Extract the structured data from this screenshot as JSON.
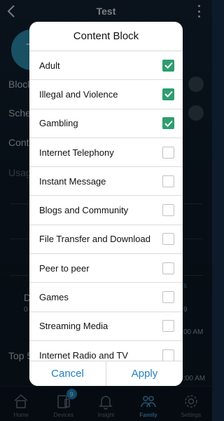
{
  "header": {
    "title": "Test"
  },
  "background": {
    "avatar_initial": "T",
    "block_label": "Block",
    "schedule_label": "Sche",
    "content_label": "Conte",
    "usage_label": "Usag",
    "day_label": "D",
    "day_sub": "0",
    "right_sub_a": "s",
    "right_sub_b": "9",
    "top_label": "Top 5",
    "time_1": "00 AM",
    "time_2": ":00 AM"
  },
  "dialog": {
    "title": "Content Block",
    "items": [
      {
        "label": "Adult",
        "checked": true
      },
      {
        "label": "Illegal and Violence",
        "checked": true
      },
      {
        "label": "Gambling",
        "checked": true
      },
      {
        "label": "Internet Telephony",
        "checked": false
      },
      {
        "label": "Instant Message",
        "checked": false
      },
      {
        "label": "Blogs and Community",
        "checked": false
      },
      {
        "label": "File Transfer and Download",
        "checked": false
      },
      {
        "label": "Peer to peer",
        "checked": false
      },
      {
        "label": "Games",
        "checked": false
      },
      {
        "label": "Streaming Media",
        "checked": false
      },
      {
        "label": "Internet Radio and TV",
        "checked": false
      }
    ],
    "cancel_label": "Cancel",
    "apply_label": "Apply"
  },
  "tabbar": {
    "tabs": [
      {
        "label": "Home",
        "icon": "home-icon"
      },
      {
        "label": "Devices",
        "icon": "devices-icon",
        "badge": "9"
      },
      {
        "label": "Insight",
        "icon": "bell-icon"
      },
      {
        "label": "Family",
        "icon": "family-icon",
        "active": true
      },
      {
        "label": "Settings",
        "icon": "gear-icon"
      }
    ]
  },
  "colors": {
    "accent": "#1f7fc4",
    "checkbox_on": "#2e9d6f",
    "tab_active": "#4aa3d8"
  }
}
